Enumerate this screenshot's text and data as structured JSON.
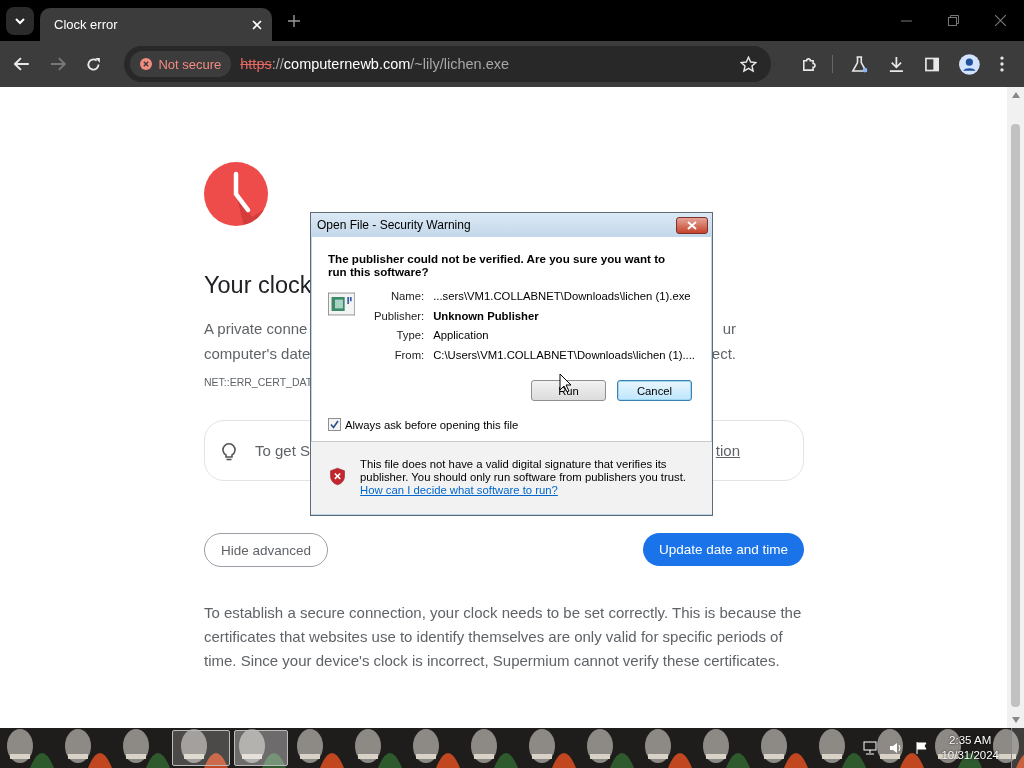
{
  "browser": {
    "tab": {
      "title": "Clock error",
      "selected": true
    },
    "address": {
      "security_label": "Not secure",
      "scheme": "https",
      "separator": "://",
      "host": "computernewb.com",
      "path": "/~lily/lichen.exe"
    }
  },
  "page": {
    "heading": "Your clock",
    "paragraph_lines": [
      {
        "left": "A private conne",
        "right": "ur"
      },
      {
        "left": "computer's date",
        "right": "ect."
      }
    ],
    "error_code": "NET::ERR_CERT_DAT",
    "tip": {
      "text": "To get S",
      "link": "tion"
    },
    "secondary_button": "Hide advanced",
    "primary_button": "Update date and time",
    "explanation": "To establish a secure connection, your clock needs to be set correctly. This is because the certificates that websites use to identify themselves are only valid for specific periods of time. Since your device's clock is incorrect, Supermium cannot verify these certificates."
  },
  "dialog": {
    "title": "Open File - Security Warning",
    "headline": "The publisher could not be verified.  Are you sure you want to run this software?",
    "fields": [
      {
        "label": "Name:",
        "value": "...sers\\VM1.COLLABNET\\Downloads\\lichen (1).exe",
        "bold": false
      },
      {
        "label": "Publisher:",
        "value": "Unknown Publisher",
        "bold": true
      },
      {
        "label": "Type:",
        "value": "Application",
        "bold": false
      },
      {
        "label": "From:",
        "value": "C:\\Users\\VM1.COLLABNET\\Downloads\\lichen (1)....",
        "bold": false
      }
    ],
    "buttons": [
      {
        "label": "Run",
        "default": false
      },
      {
        "label": "Cancel",
        "default": true
      }
    ],
    "checkbox": {
      "label": "Always ask before opening this file",
      "checked": true
    },
    "warning": "This file does not have a valid digital signature that verifies its publisher.  You should only run software from publishers you trust.",
    "help_link": "How can I decide what software to run?"
  },
  "taskbar": {
    "time": "2:35 AM",
    "date": "10/31/2024"
  }
}
